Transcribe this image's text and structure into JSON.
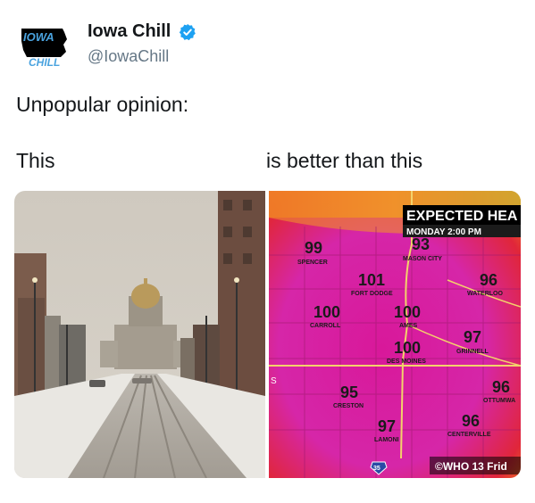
{
  "account": {
    "display_name": "Iowa Chill",
    "handle": "@IowaChill",
    "avatar_text_top": "IOWA",
    "avatar_text_bottom": "CHILL",
    "verified": true
  },
  "tweet": {
    "text": "Unpopular opinion:",
    "caption_left": "This",
    "caption_right": "is better than this"
  },
  "weather_map": {
    "title": "EXPECTED HEA",
    "subtitle": "MONDAY 2:00 PM",
    "watermark": "©WHO 13 Frid",
    "highway": "35",
    "cities": [
      {
        "temp": "99",
        "name": "SPENCER"
      },
      {
        "temp": "93",
        "name": "MASON CITY"
      },
      {
        "temp": "101",
        "name": "FORT DODGE"
      },
      {
        "temp": "96",
        "name": "WATERLOO"
      },
      {
        "temp": "100",
        "name": "CARROLL"
      },
      {
        "temp": "100",
        "name": "AMES"
      },
      {
        "temp": "97",
        "name": "GRINNELL"
      },
      {
        "temp": "100",
        "name": "DES MOINES"
      },
      {
        "temp": "95",
        "name": "CRESTON"
      },
      {
        "temp": "96",
        "name": "OTTUMWA"
      },
      {
        "temp": "97",
        "name": "LAMONI"
      },
      {
        "temp": "96",
        "name": "CENTERVILLE"
      }
    ],
    "map_edge_letter": "S"
  },
  "colors": {
    "verified_blue": "#1da1f2",
    "avatar_blue": "#4aa3df",
    "heat_magenta": "#d41fa0",
    "heat_red": "#e0263a",
    "heat_orange": "#f07a1c"
  }
}
